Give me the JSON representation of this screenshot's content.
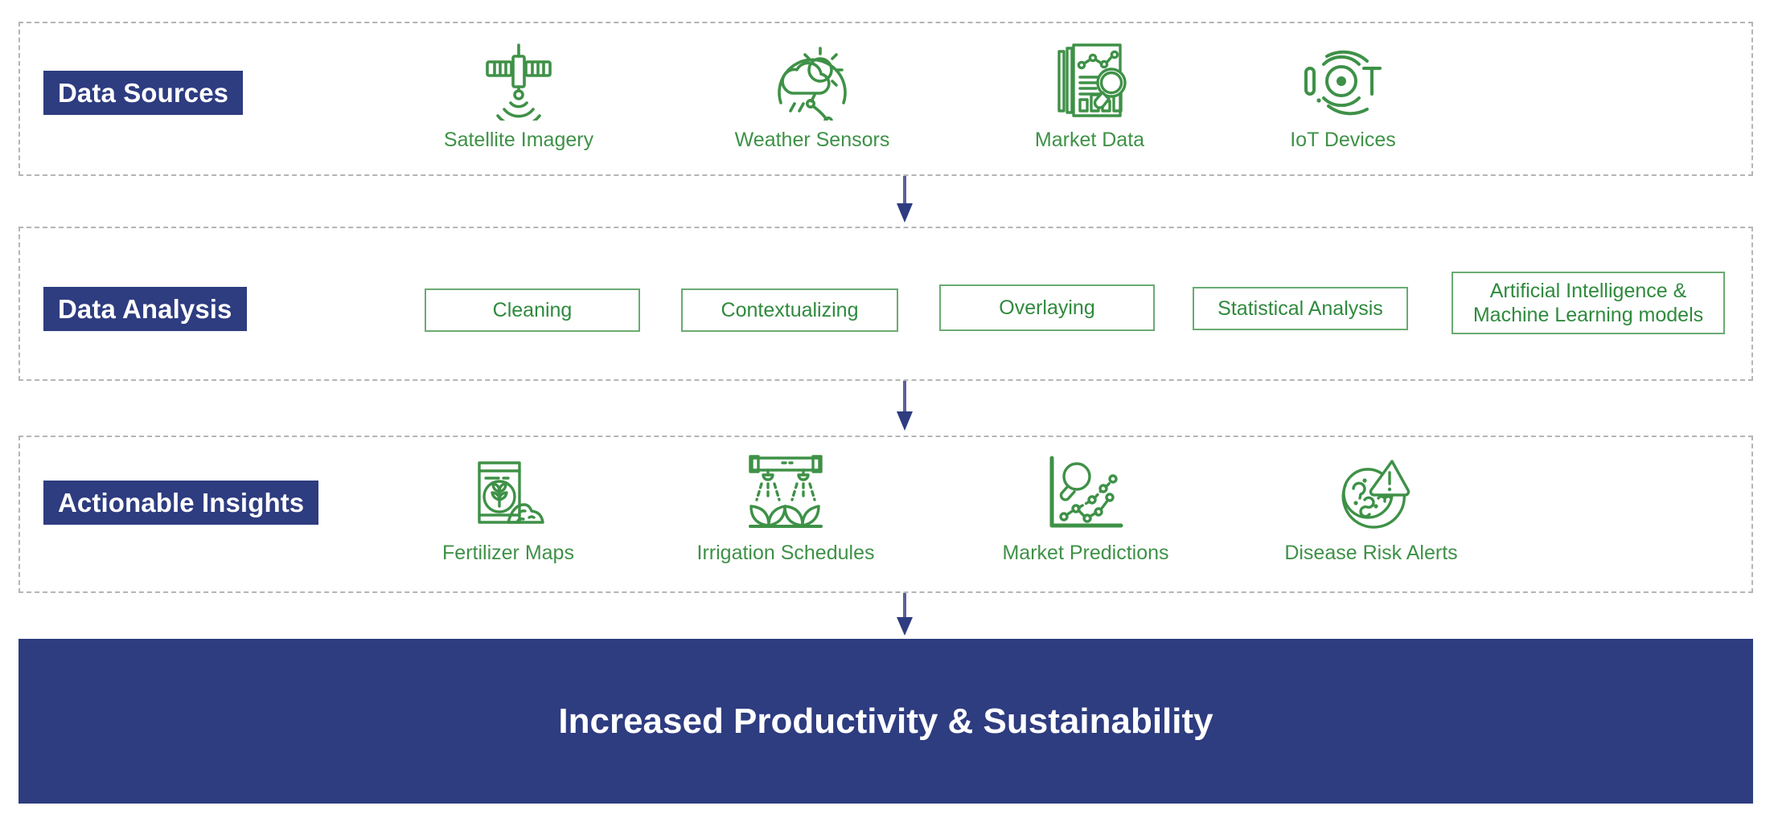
{
  "theme": {
    "navy": "#2e3c80",
    "green": "#3e9147",
    "box_border_green": "#6aab72",
    "dashed_border": "#b5b5b5",
    "background": "#ffffff"
  },
  "sections": [
    {
      "id": "sources",
      "label": "Data Sources",
      "items": [
        {
          "label": "Satellite Imagery",
          "icon": "satellite-icon"
        },
        {
          "label": "Weather Sensors",
          "icon": "weather-sensor-icon"
        },
        {
          "label": "Market Data",
          "icon": "market-report-icon"
        },
        {
          "label": "IoT Devices",
          "icon": "iot-icon"
        }
      ]
    },
    {
      "id": "analysis",
      "label": "Data Analysis",
      "steps": [
        {
          "label": "Cleaning"
        },
        {
          "label": "Contextualizing"
        },
        {
          "label": "Overlaying"
        },
        {
          "label": "Statistical Analysis"
        },
        {
          "label": "Artificial Intelligence &\nMachine Learning models"
        }
      ]
    },
    {
      "id": "insights",
      "label": "Actionable Insights",
      "items": [
        {
          "label": "Fertilizer Maps",
          "icon": "fertilizer-bag-icon"
        },
        {
          "label": "Irrigation Schedules",
          "icon": "irrigation-sprinkler-icon"
        },
        {
          "label": "Market Predictions",
          "icon": "market-prediction-chart-icon"
        },
        {
          "label": "Disease Risk Alerts",
          "icon": "disease-risk-icon"
        }
      ]
    }
  ],
  "connectors": [
    {
      "name": "arrow-sources-to-analysis",
      "icon": "arrow-down-icon"
    },
    {
      "name": "arrow-analysis-to-insights",
      "icon": "arrow-down-icon"
    },
    {
      "name": "arrow-insights-to-outcome",
      "icon": "arrow-down-icon"
    }
  ],
  "outcome": {
    "label": "Increased Productivity & Sustainability"
  }
}
